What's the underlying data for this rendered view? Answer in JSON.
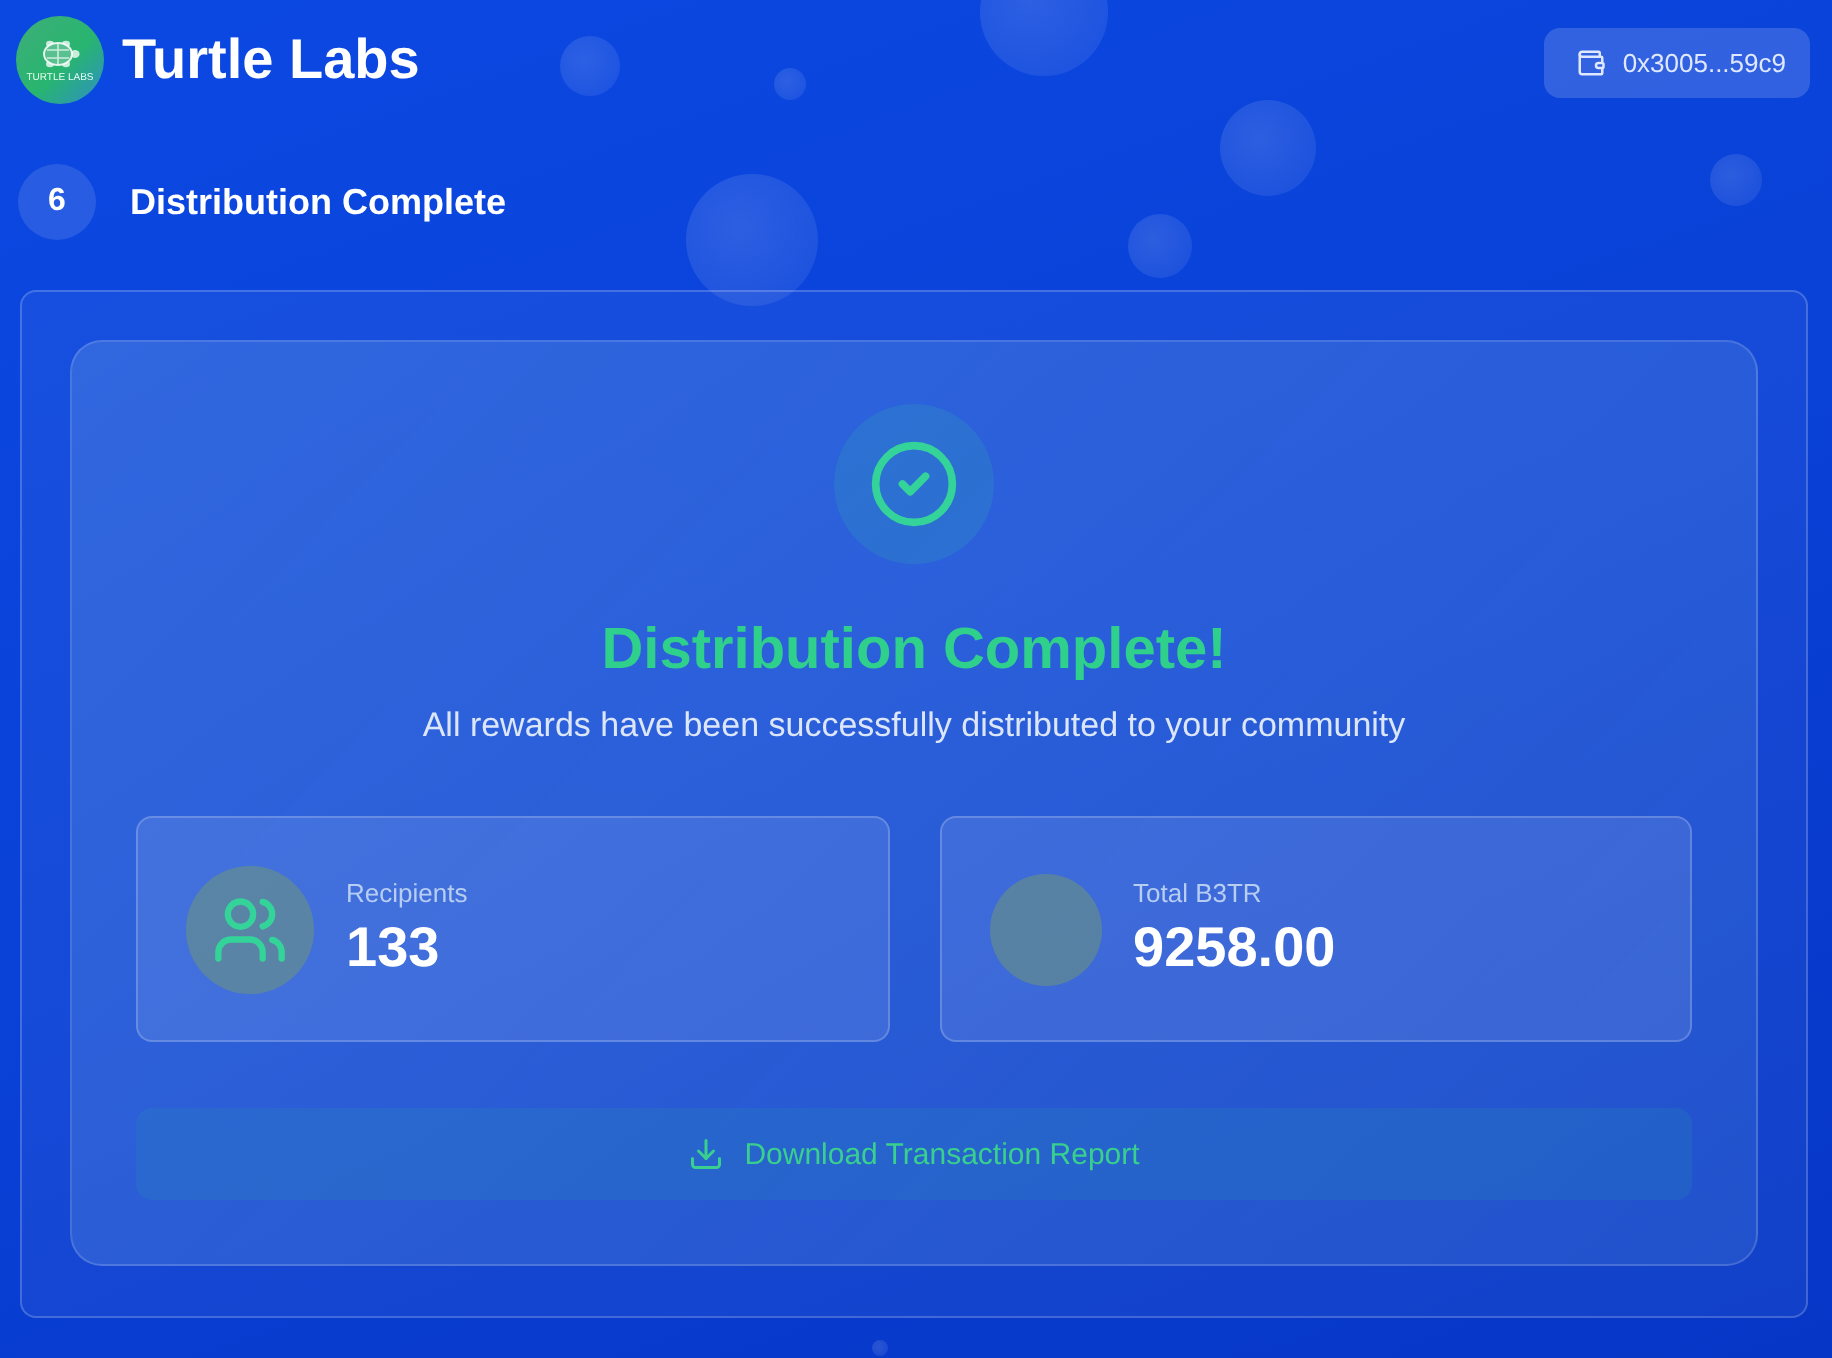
{
  "header": {
    "logo": {
      "text": "TURTLE LABS"
    },
    "title": "Turtle Labs",
    "wallet": {
      "address": "0x3005...59c9"
    }
  },
  "step": {
    "number": "6",
    "title": "Distribution Complete"
  },
  "result": {
    "title": "Distribution Complete!",
    "message": "All rewards have been successfully distributed to your community",
    "stats": [
      {
        "kind": "users",
        "label": "Recipients",
        "value": "133"
      },
      {
        "kind": "token",
        "label": "Total B3TR",
        "value": "9258.00"
      }
    ],
    "download_button": "Download Transaction Report"
  }
}
